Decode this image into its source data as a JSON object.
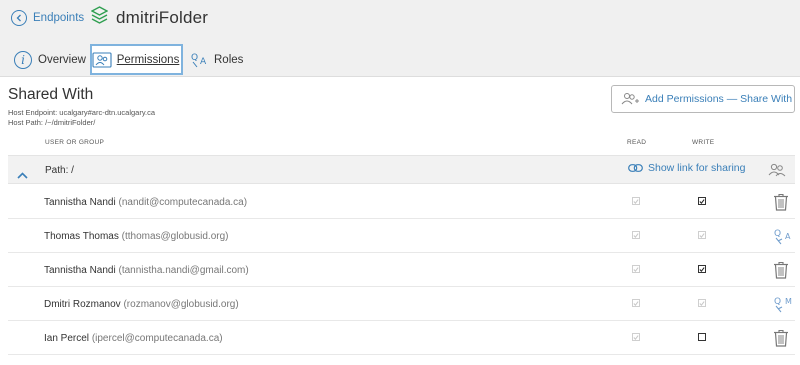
{
  "header": {
    "back_label": "Endpoints",
    "title": "dmitriFolder"
  },
  "tabs": [
    {
      "label": "Overview",
      "icon": "info-icon",
      "active": false
    },
    {
      "label": "Permissions",
      "icon": "permissions-icon",
      "active": true
    },
    {
      "label": "Roles",
      "icon": "roles-icon",
      "active": false
    }
  ],
  "shared": {
    "title": "Shared With",
    "host_endpoint": "Host Endpoint: ucalgary#arc-dtn.ucalgary.ca",
    "host_path": "Host Path: /~/dmitriFolder/",
    "add_button": "Add Permissions — Share With"
  },
  "columns": {
    "user": "USER OR GROUP",
    "read": "READ",
    "write": "WRITE"
  },
  "path_row": {
    "label": "Path:  /",
    "share_link": "Show link for sharing"
  },
  "rows": [
    {
      "name": "Tannistha Nandi",
      "email": "(nandit@computecanada.ca)",
      "read": true,
      "write": true,
      "action": "trash-icon"
    },
    {
      "name": "Thomas Thomas",
      "email": "(tthomas@globusid.org)",
      "read": true,
      "write": true,
      "action": "role-admin-icon"
    },
    {
      "name": "Tannistha Nandi",
      "email": "(tannistha.nandi@gmail.com)",
      "read": true,
      "write": true,
      "action": "trash-icon"
    },
    {
      "name": "Dmitri Rozmanov",
      "email": "(rozmanov@globusid.org)",
      "read": true,
      "write": true,
      "action": "role-manager-icon"
    },
    {
      "name": "Ian Percel",
      "email": "(ipercel@computecanada.ca)",
      "read": true,
      "write": false,
      "action": "trash-icon"
    }
  ],
  "colors": {
    "accent": "#3a7fb8",
    "header_bg": "#f0f0f0",
    "active_tab_border": "#7fb3de",
    "logo_green": "#2e9e4f"
  }
}
